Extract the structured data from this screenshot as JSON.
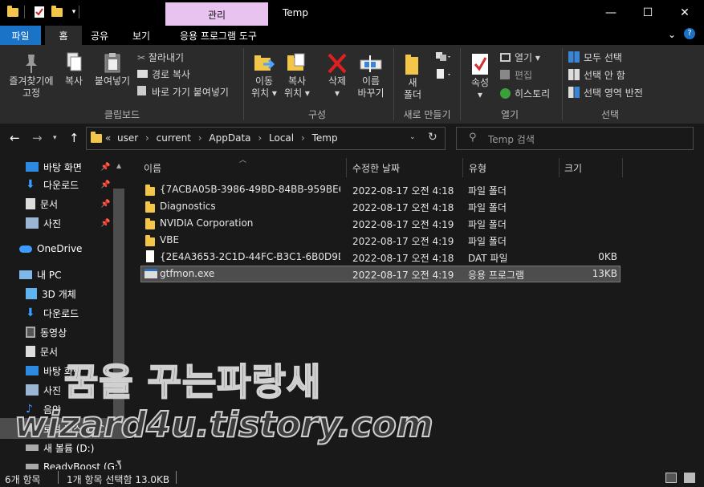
{
  "window": {
    "title": "Temp",
    "context_tab": "관리",
    "minimize": "—",
    "maximize": "☐",
    "close": "✕"
  },
  "tabs": {
    "file": "파일",
    "home": "홈",
    "share": "공유",
    "view": "보기",
    "app_tools": "응용 프로그램 도구"
  },
  "ribbon": {
    "clipboard": {
      "pin_quick": "즐겨찾기에\n고정",
      "copy": "복사",
      "paste": "붙여넣기",
      "cut": "잘라내기",
      "copy_path": "경로 복사",
      "paste_shortcut": "바로 가기 붙여넣기",
      "label": "클립보드"
    },
    "organize": {
      "move_to": "이동\n위치 ▾",
      "copy_to": "복사\n위치 ▾",
      "delete": "삭제",
      "rename": "이름\n바꾸기",
      "label": "구성"
    },
    "new": {
      "new_folder": "새\n폴더",
      "label": "새로 만들기"
    },
    "open": {
      "properties": "속성",
      "open": "열기 ▾",
      "edit": "편집",
      "history": "히스토리",
      "label": "열기"
    },
    "select": {
      "select_all": "모두 선택",
      "select_none": "선택 안 함",
      "invert": "선택 영역 반전",
      "label": "선택"
    }
  },
  "address": {
    "chevron": "«",
    "crumbs": [
      "user",
      "current",
      "AppData",
      "Local",
      "Temp"
    ],
    "search_placeholder": "Temp 검색"
  },
  "nav": {
    "quick": [
      {
        "label": "바탕 화면",
        "icon": "desktop-icon"
      },
      {
        "label": "다운로드",
        "icon": "download-icon"
      },
      {
        "label": "문서",
        "icon": "document-icon"
      },
      {
        "label": "사진",
        "icon": "picture-icon"
      }
    ],
    "onedrive": "OneDrive",
    "thispc": "내 PC",
    "pc_items": [
      {
        "label": "3D 개체",
        "icon": "cube-icon"
      },
      {
        "label": "다운로드",
        "icon": "download-icon"
      },
      {
        "label": "동영상",
        "icon": "video-icon"
      },
      {
        "label": "문서",
        "icon": "document-icon"
      },
      {
        "label": "바탕 화면",
        "icon": "desktop-icon"
      },
      {
        "label": "사진",
        "icon": "picture-icon"
      },
      {
        "label": "음악",
        "icon": "music-icon"
      },
      {
        "label": "로컬 디스크 (C:)",
        "icon": "drive-icon"
      },
      {
        "label": "새 볼륨 (D:)",
        "icon": "drive-icon"
      },
      {
        "label": "ReadyBoost (G:)",
        "icon": "drive-icon"
      }
    ]
  },
  "columns": {
    "name": "이름",
    "modified": "수정한 날짜",
    "type": "유형",
    "size": "크기"
  },
  "files": [
    {
      "name": "{7ACBA05B-3986-49BD-84BB-959BE6...",
      "modified": "2022-08-17 오전 4:18",
      "type": "파일 폴더",
      "size": "",
      "kind": "folder"
    },
    {
      "name": "Diagnostics",
      "modified": "2022-08-17 오전 4:18",
      "type": "파일 폴더",
      "size": "",
      "kind": "folder"
    },
    {
      "name": "NVIDIA Corporation",
      "modified": "2022-08-17 오전 4:19",
      "type": "파일 폴더",
      "size": "",
      "kind": "folder"
    },
    {
      "name": "VBE",
      "modified": "2022-08-17 오전 4:19",
      "type": "파일 폴더",
      "size": "",
      "kind": "folder"
    },
    {
      "name": "{2E4A3653-2C1D-44FC-B3C1-6B0D9D...",
      "modified": "2022-08-17 오전 4:18",
      "type": "DAT 파일",
      "size": "0KB",
      "kind": "file"
    },
    {
      "name": "gtfmon.exe",
      "modified": "2022-08-17 오전 4:19",
      "type": "응용 프로그램",
      "size": "13KB",
      "kind": "exe",
      "selected": true
    }
  ],
  "status": {
    "count": "6개 항목",
    "selection": "1개 항목 선택함 13.0KB"
  },
  "watermark": {
    "line1": "꿈을 꾸는파랑새",
    "line2": "wizard4u.tistory.com"
  },
  "colors": {
    "accent": "#1a73c7",
    "context_tab": "#e9c3f0",
    "folder": "#f3c548",
    "selection": "#4d4d4d"
  }
}
